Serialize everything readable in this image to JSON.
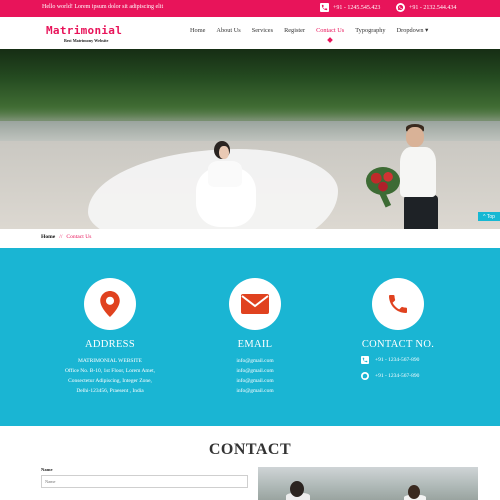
{
  "topbar": {
    "hello": "Hello world! Lorem ipsum dolor sit adipiscing elit",
    "phone1": "+91 - 1245.545.423",
    "phone2": "+91 - 2132.544.434",
    "bg_color": "#e8145a"
  },
  "header": {
    "logo": "Matrimonial",
    "logo_sub": "Best Matrimony Website"
  },
  "nav": {
    "items": [
      {
        "label": "Home"
      },
      {
        "label": "About Us"
      },
      {
        "label": "Services"
      },
      {
        "label": "Register"
      },
      {
        "label": "Contact Us",
        "active": true
      },
      {
        "label": "Typography"
      },
      {
        "label": "Dropdown"
      }
    ],
    "dropdown_caret": "▾"
  },
  "hero": {
    "top_button": "Top",
    "top_icon": "arrow-up-icon"
  },
  "breadcrumb": {
    "home": "Home",
    "separator": "//",
    "current": "Contact Us"
  },
  "info": {
    "bg_color": "#1ab5d3",
    "address": {
      "icon": "map-pin-icon",
      "title": "ADDRESS",
      "lines": [
        "MATRIMONIAL WEBSITE",
        "Office No. B-10, 1st Floor, Lorem Amet,",
        "Consectetur Adipiscing, Integer Zone,",
        "Delhi-123456, Praesent , India"
      ]
    },
    "email": {
      "icon": "envelope-icon",
      "title": "EMAIL",
      "lines": [
        "info@gmail.com",
        "info@gmail.com",
        "info@gmail.com",
        "info@gmail.com"
      ]
    },
    "contact": {
      "icon": "phone-icon",
      "title": "CONTACT NO.",
      "phone1": "+91 - 1234-567-890",
      "phone2": "+91 - 1234-567-890"
    },
    "icon_color": "#e0421f"
  },
  "contact_form": {
    "title": "CONTACT",
    "name_label": "Name",
    "name_placeholder": "Name"
  }
}
